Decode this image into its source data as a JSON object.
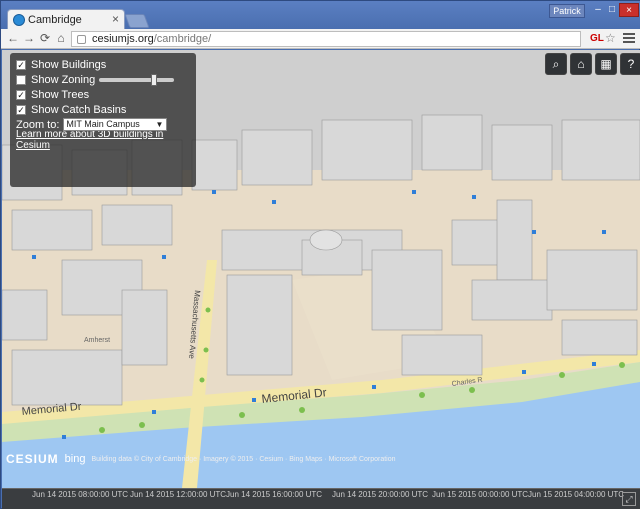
{
  "browser": {
    "tab_title": "Cambridge",
    "user": "Patrick",
    "url_host": "cesiumjs.org",
    "url_path": "/cambridge/",
    "gl_badge": "GL"
  },
  "panel": {
    "show_buildings": "Show Buildings",
    "show_zoning": "Show Zoning",
    "show_trees": "Show Trees",
    "show_catch_basins": "Show Catch Basins",
    "zoom_label": "Zoom to:",
    "zoom_value": "MIT Main Campus",
    "learn_more": "Learn more about 3D buildings in Cesium"
  },
  "map_labels": {
    "street1": "Memorial Dr",
    "street2": "Memorial Dr",
    "avenue": "Massachusetts Ave",
    "amherst": "Amherst",
    "charles": "Charles R"
  },
  "credits": {
    "cesium": "CESIUM",
    "bing": "bing",
    "text": "Building data © City of Cambridge · Imagery © 2015 · Cesium · Bing Maps · Microsoft Corporation"
  },
  "timeline": [
    "Jun 14 2015 08:00:00 UTC",
    "Jun 14 2015 12:00:00 UTC",
    "Jun 14 2015 16:00:00 UTC",
    "Jun 14 2015 20:00:00 UTC",
    "Jun 15 2015 00:00:00 UTC",
    "Jun 15 2015 04:00:00 UTC"
  ],
  "colors": {
    "water": "#9ec7f2",
    "park": "#d9e8c2",
    "ground": "#e8dcc8",
    "building": "#d8d8d8",
    "road": "#f5e39a",
    "basin": "#2f7ed8"
  }
}
